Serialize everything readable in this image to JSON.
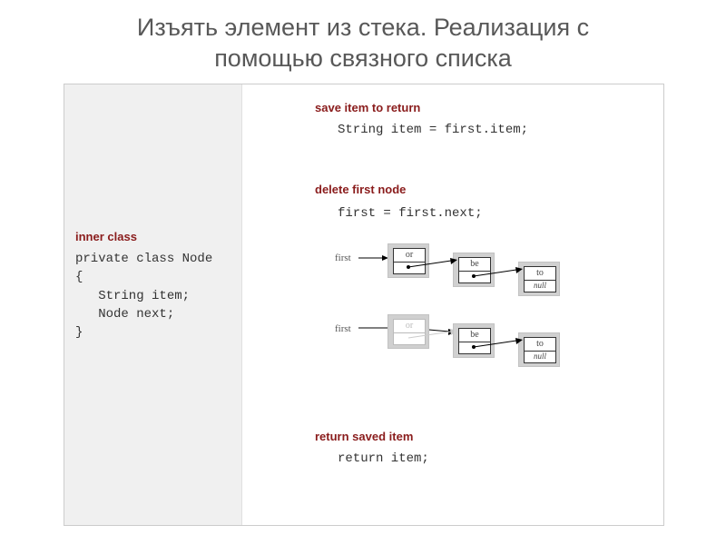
{
  "title_line1": "Изъять элемент из стека. Реализация с",
  "title_line2": "помощью связного списка",
  "left": {
    "heading": "inner class",
    "code": "private class Node\n{\n   String item;\n   Node next;\n}"
  },
  "right": {
    "step1_heading": "save item to return",
    "step1_code": "String item = first.item;",
    "step2_heading": "delete first node",
    "step2_code": "first = first.next;",
    "first_label": "first",
    "nodes": {
      "a": "or",
      "b": "be",
      "c": "to",
      "null": "null"
    },
    "step3_heading": "return saved item",
    "step3_code": "return item;"
  }
}
